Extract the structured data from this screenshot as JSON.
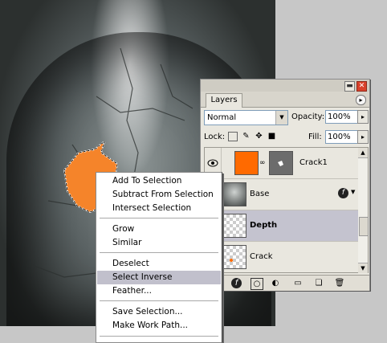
{
  "context_menu": {
    "items": [
      {
        "label": "Add To Selection"
      },
      {
        "label": "Subtract From Selection"
      },
      {
        "label": "Intersect Selection"
      },
      {
        "label": "Grow"
      },
      {
        "label": "Similar"
      },
      {
        "label": "Deselect"
      },
      {
        "label": "Select Inverse",
        "highlighted": true
      },
      {
        "label": "Feather..."
      },
      {
        "label": "Save Selection..."
      },
      {
        "label": "Make Work Path..."
      }
    ]
  },
  "layers_panel": {
    "title_buttons": {
      "minimize": "▬",
      "close": "✕"
    },
    "tab_label": "Layers",
    "menu_button": "▸",
    "blend_mode": "Normal",
    "opacity_label": "Opacity:",
    "opacity_value": "100%",
    "lock_label": "Lock:",
    "fill_label": "Fill:",
    "fill_value": "100%",
    "layers": [
      {
        "name": "Crack1",
        "visible": true,
        "thumb_color": "#ff6a00"
      },
      {
        "name": "Base",
        "visible": false,
        "has_effects": true
      },
      {
        "name": "Depth",
        "visible": false,
        "selected": true
      },
      {
        "name": "Crack",
        "visible": false
      }
    ],
    "scroll_up": "▲",
    "scroll_down": "▼",
    "bottom_icons": [
      "link-icon",
      "layer-style-icon",
      "mask-icon",
      "adjustment-icon",
      "folder-icon",
      "new-layer-icon",
      "trash-icon"
    ]
  },
  "colors": {
    "selection_fill": "#f5842a",
    "menu_highlight": "#c1c0cc",
    "selected_layer": "#c4c3cf"
  }
}
